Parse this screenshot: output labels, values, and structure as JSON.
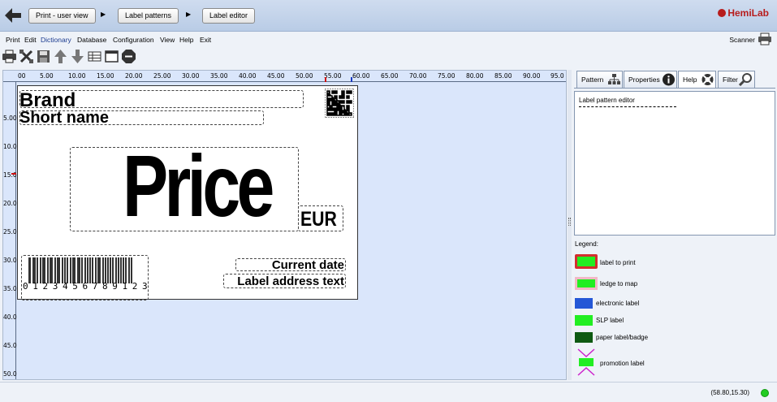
{
  "header": {
    "breadcrumbs": [
      "Print - user view",
      "Label patterns",
      "Label editor"
    ],
    "separator": "▶",
    "logo_text": "HemiLab",
    "logo_color": "#b71c1c"
  },
  "menu": {
    "items": [
      "Print",
      "Edit",
      "Dictionary",
      "Database",
      "Configuration",
      "View",
      "Help",
      "Exit"
    ],
    "active": "Dictionary",
    "scanner_label": "Scanner"
  },
  "toolbar": {
    "icons": [
      "printer-icon",
      "crop-icon",
      "save-icon",
      "arrow-up-icon",
      "arrow-down-icon",
      "table-icon",
      "window-icon",
      "stop-icon"
    ]
  },
  "rulers": {
    "top": [
      "00",
      "5.00",
      "10.00",
      "15.00",
      "20.00",
      "25.00",
      "30.00",
      "35.00",
      "40.00",
      "45.00",
      "50.00",
      "55.00",
      "60.00",
      "65.00",
      "70.00",
      "75.00",
      "80.00",
      "85.00",
      "90.00",
      "95.0"
    ],
    "left": [
      "5.00",
      "10.0",
      "15.0",
      "20.0",
      "25.0",
      "30.0",
      "35.0",
      "40.0",
      "45.0",
      "50.0"
    ]
  },
  "label": {
    "brand": "Brand",
    "short_name": "Short name",
    "price": "Price",
    "currency": "EUR",
    "barcode_digits": "0 1 2 3 4 5 6 7 8 9 1 2 3",
    "current_date": "Current date",
    "address": "Label address text"
  },
  "right_panel": {
    "tabs": [
      "Pattern",
      "Properties",
      "Help",
      "Filter"
    ],
    "active_tab": "Help",
    "help_title": "Label pattern editor",
    "legend_title": "Legend:",
    "legend": [
      {
        "label": "label to print",
        "color": "#22ee22",
        "border": "#d32f2f"
      },
      {
        "label": "ledge to map",
        "color": "#22ee22",
        "border": "#f2b8c6"
      },
      {
        "label": "electronic label",
        "color": "#2457d6"
      },
      {
        "label": "SLP label",
        "color": "#22ee22"
      },
      {
        "label": "paper label/badge",
        "color": "#0e5a12"
      },
      {
        "label": "promotion label",
        "color": "#22ee22",
        "mark": "#cc22cc"
      }
    ]
  },
  "status": {
    "coords": "(58.80,15.30)",
    "indicator_color": "#22cc22"
  }
}
